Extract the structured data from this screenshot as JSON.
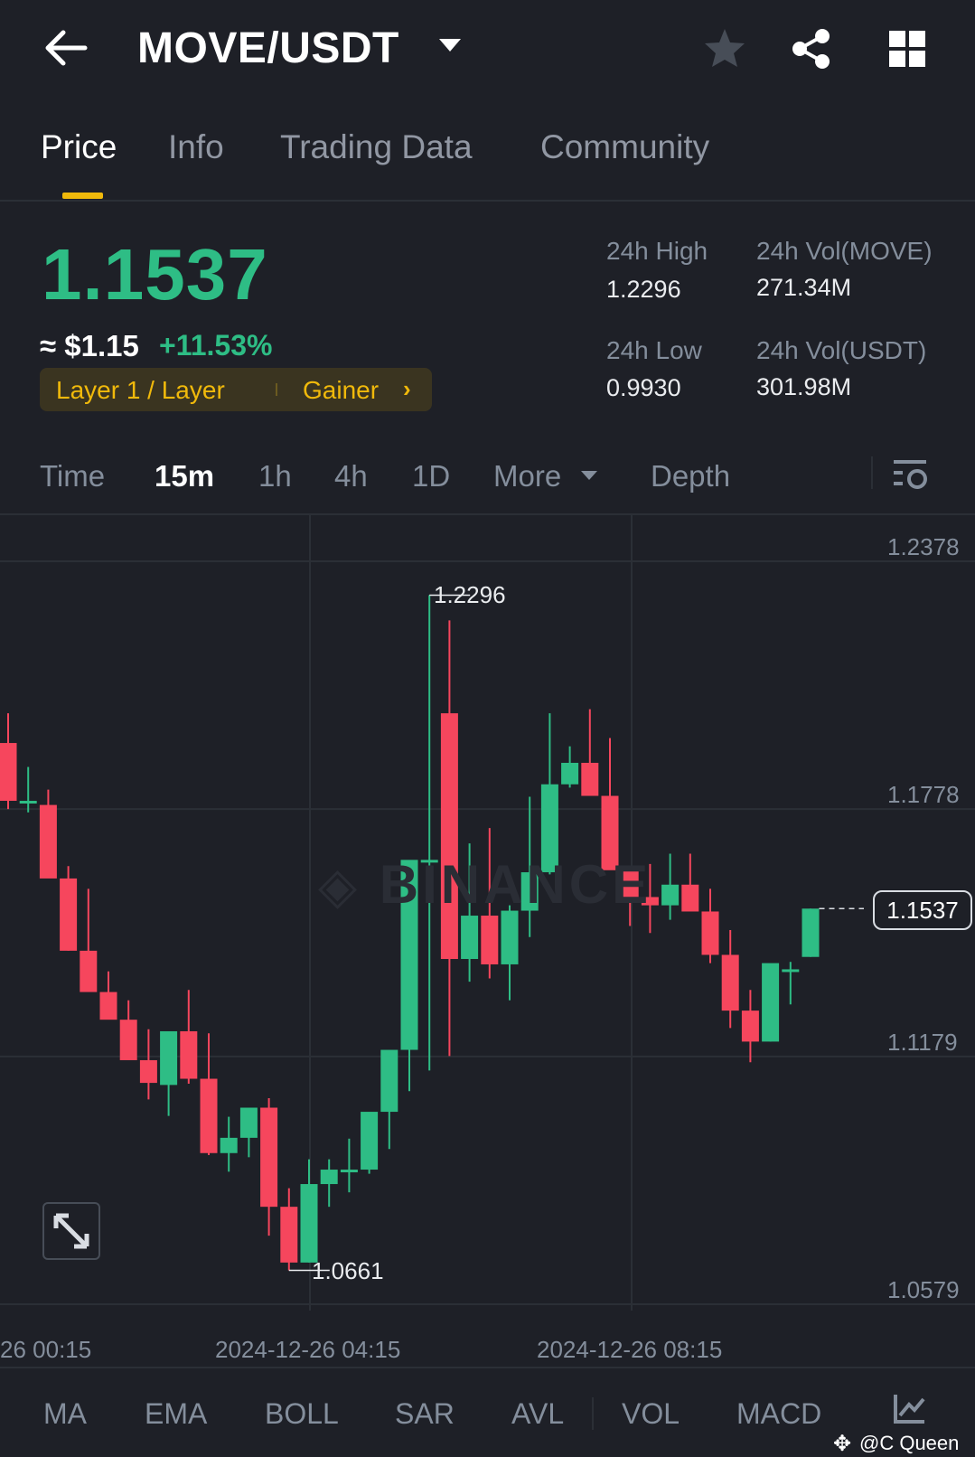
{
  "header": {
    "pair": "MOVE/USDT",
    "icons": [
      "back-arrow-icon",
      "caret-down-icon",
      "star-icon",
      "share-icon",
      "grid-icon"
    ]
  },
  "tabs": [
    {
      "label": "Price",
      "active": true
    },
    {
      "label": "Info",
      "active": false
    },
    {
      "label": "Trading Data",
      "active": false
    },
    {
      "label": "Community",
      "active": false
    }
  ],
  "price": {
    "last": "1.1537",
    "usd": "≈ $1.15",
    "change": "+11.53%",
    "tag_category": "Layer 1 / Layer",
    "tag_type": "Gainer",
    "positive_color": "#2ebd85",
    "negative_color": "#f6465d",
    "accent_color": "#f0b90b"
  },
  "stats": {
    "high_label": "24h High",
    "high_value": "1.2296",
    "low_label": "24h Low",
    "low_value": "0.9930",
    "vol_base_label": "24h Vol(MOVE)",
    "vol_base_value": "271.34M",
    "vol_quote_label": "24h Vol(USDT)",
    "vol_quote_value": "301.98M"
  },
  "intervals": {
    "time": "Time",
    "m15": "15m",
    "h1": "1h",
    "h4": "4h",
    "d1": "1D",
    "more": "More",
    "depth": "Depth",
    "active": "15m"
  },
  "chart_data": {
    "type": "candlestick",
    "interval": "15m",
    "y_ticks": [
      "1.2378",
      "1.1778",
      "1.1179",
      "1.0579"
    ],
    "ylim": [
      1.0579,
      1.2378
    ],
    "x_ticks": [
      "26 00:15",
      "2024-12-26 04:15",
      "2024-12-26 08:15"
    ],
    "high_marker": "1.2296",
    "low_marker": "1.0661",
    "last_price_label": "1.1537",
    "watermark": "BINANCE",
    "candles": [
      {
        "o": 1.1938,
        "h": 1.201,
        "l": 1.1778,
        "c": 1.1798
      },
      {
        "o": 1.1798,
        "h": 1.188,
        "l": 1.177,
        "c": 1.1798
      },
      {
        "o": 1.1788,
        "h": 1.1825,
        "l": 1.1618,
        "c": 1.161
      },
      {
        "o": 1.161,
        "h": 1.164,
        "l": 1.1435,
        "c": 1.1435
      },
      {
        "o": 1.1435,
        "h": 1.1585,
        "l": 1.1365,
        "c": 1.1335
      },
      {
        "o": 1.1335,
        "h": 1.1385,
        "l": 1.128,
        "c": 1.1268
      },
      {
        "o": 1.1268,
        "h": 1.1315,
        "l": 1.1195,
        "c": 1.117
      },
      {
        "o": 1.117,
        "h": 1.1245,
        "l": 1.1075,
        "c": 1.1115
      },
      {
        "o": 1.111,
        "h": 1.124,
        "l": 1.1035,
        "c": 1.124
      },
      {
        "o": 1.124,
        "h": 1.134,
        "l": 1.1113,
        "c": 1.1125
      },
      {
        "o": 1.1125,
        "h": 1.1235,
        "l": 1.094,
        "c": 1.0945
      },
      {
        "o": 1.0945,
        "h": 1.1033,
        "l": 1.09,
        "c": 1.0982
      },
      {
        "o": 1.0982,
        "h": 1.1028,
        "l": 1.0935,
        "c": 1.1055
      },
      {
        "o": 1.1055,
        "h": 1.1078,
        "l": 1.0745,
        "c": 1.0815
      },
      {
        "o": 1.0815,
        "h": 1.086,
        "l": 1.0661,
        "c": 1.068
      },
      {
        "o": 1.068,
        "h": 1.093,
        "l": 1.068,
        "c": 1.087
      },
      {
        "o": 1.087,
        "h": 1.093,
        "l": 1.0815,
        "c": 1.0905
      },
      {
        "o": 1.0905,
        "h": 1.098,
        "l": 1.085,
        "c": 1.0905
      },
      {
        "o": 1.0905,
        "h": 1.103,
        "l": 1.0895,
        "c": 1.1045
      },
      {
        "o": 1.1045,
        "h": 1.119,
        "l": 1.0955,
        "c": 1.1195
      },
      {
        "o": 1.1195,
        "h": 1.128,
        "l": 1.1095,
        "c": 1.1655
      },
      {
        "o": 1.1655,
        "h": 1.2296,
        "l": 1.1145,
        "c": 1.1655
      },
      {
        "o": 1.201,
        "h": 1.2235,
        "l": 1.118,
        "c": 1.1415
      },
      {
        "o": 1.1415,
        "h": 1.1695,
        "l": 1.136,
        "c": 1.152
      },
      {
        "o": 1.152,
        "h": 1.1732,
        "l": 1.1368,
        "c": 1.1402
      },
      {
        "o": 1.1402,
        "h": 1.1545,
        "l": 1.1315,
        "c": 1.1532
      },
      {
        "o": 1.1532,
        "h": 1.1808,
        "l": 1.1468,
        "c": 1.1625
      },
      {
        "o": 1.1625,
        "h": 1.201,
        "l": 1.162,
        "c": 1.1838
      },
      {
        "o": 1.1838,
        "h": 1.193,
        "l": 1.183,
        "c": 1.189
      },
      {
        "o": 1.189,
        "h": 1.202,
        "l": 1.1825,
        "c": 1.181
      },
      {
        "o": 1.181,
        "h": 1.195,
        "l": 1.1708,
        "c": 1.163
      },
      {
        "o": 1.163,
        "h": 1.163,
        "l": 1.1495,
        "c": 1.1565
      },
      {
        "o": 1.1565,
        "h": 1.1645,
        "l": 1.1478,
        "c": 1.1545
      },
      {
        "o": 1.1545,
        "h": 1.167,
        "l": 1.151,
        "c": 1.1595
      },
      {
        "o": 1.1595,
        "h": 1.167,
        "l": 1.1555,
        "c": 1.153
      },
      {
        "o": 1.153,
        "h": 1.1585,
        "l": 1.1405,
        "c": 1.1425
      },
      {
        "o": 1.1425,
        "h": 1.1485,
        "l": 1.1248,
        "c": 1.129
      },
      {
        "o": 1.129,
        "h": 1.134,
        "l": 1.1165,
        "c": 1.1215
      },
      {
        "o": 1.1215,
        "h": 1.1375,
        "l": 1.1215,
        "c": 1.1405
      },
      {
        "o": 1.1385,
        "h": 1.1408,
        "l": 1.1305,
        "c": 1.139
      },
      {
        "o": 1.142,
        "h": 1.1537,
        "l": 1.142,
        "c": 1.1537
      }
    ]
  },
  "indicators": [
    "MA",
    "EMA",
    "BOLL",
    "SAR",
    "AVL",
    "VOL",
    "MACD"
  ],
  "watermark": "@C Queen"
}
